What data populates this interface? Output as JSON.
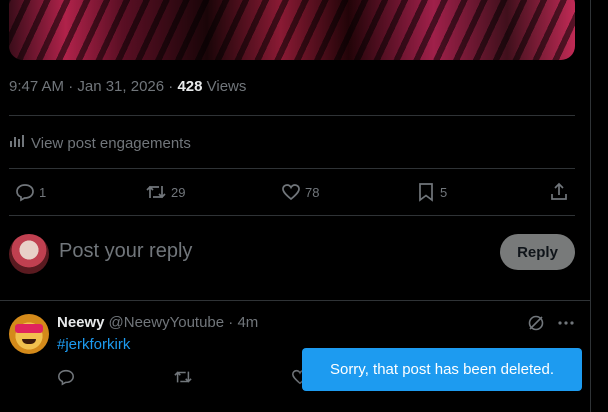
{
  "post": {
    "timestamp": "9:47 AM · Jan 31, 2026 · ",
    "views_count": "428",
    "views_label": " Views",
    "engagements_label": "View post engagements",
    "replies": "1",
    "reposts": "29",
    "likes": "78",
    "bookmarks": "5"
  },
  "compose": {
    "placeholder": "Post your reply",
    "reply_button": "Reply"
  },
  "reply_tweet": {
    "name": "Neewy",
    "handle": "@NeewyYoutube · 4m",
    "hashtag": "#jerkforkirk"
  },
  "toast": {
    "message": "Sorry, that post has been deleted."
  },
  "colors": {
    "background": "#000000",
    "muted": "#71767b",
    "accent": "#1d9bf0",
    "divider": "#2f3336"
  },
  "icons": [
    "analytics-icon",
    "reply-icon",
    "repost-icon",
    "like-icon",
    "bookmark-icon",
    "share-icon",
    "grok-icon",
    "more-icon"
  ]
}
